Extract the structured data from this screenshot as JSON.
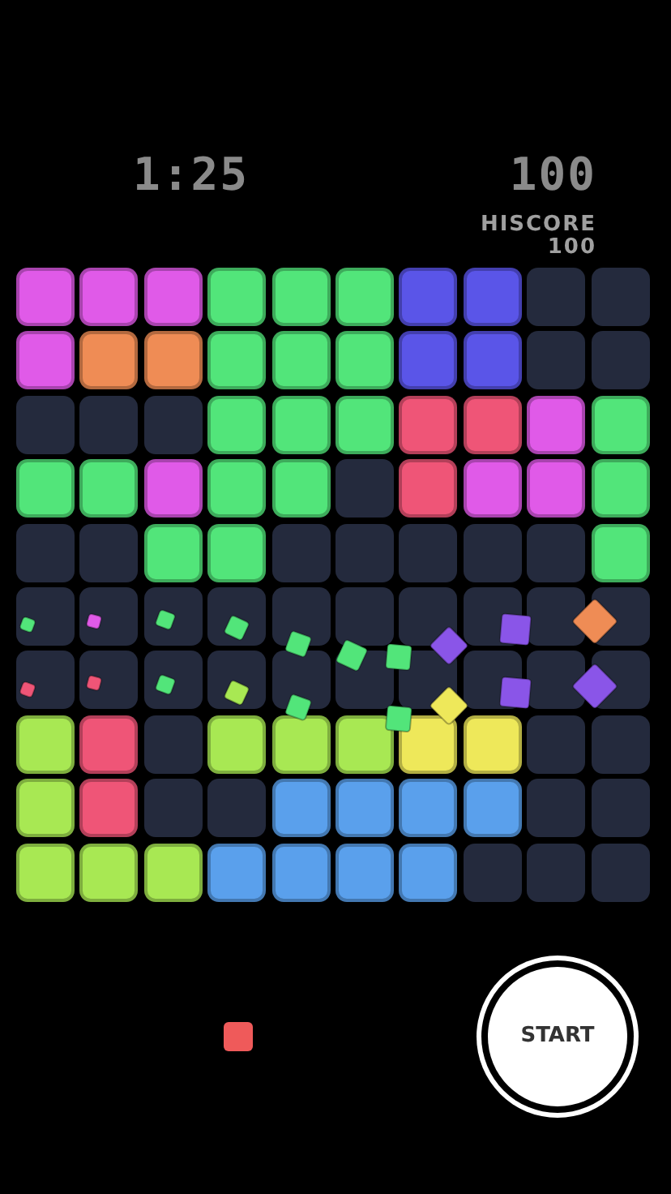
{
  "timer": "1:25",
  "score": "100",
  "hiscore": {
    "label": "HISCORE",
    "value": "100"
  },
  "grid": [
    [
      {
        "filled": true,
        "color": "#e05ae8"
      },
      {
        "filled": true,
        "color": "#e05ae8"
      },
      {
        "filled": true,
        "color": "#e05ae8"
      },
      {
        "filled": true,
        "color": "#52e57a"
      },
      {
        "filled": true,
        "color": "#52e57a"
      },
      {
        "filled": true,
        "color": "#52e57a"
      },
      {
        "filled": true,
        "color": "#5a55e8"
      },
      {
        "filled": true,
        "color": "#5a55e8"
      },
      {
        "filled": false
      },
      {
        "filled": false
      }
    ],
    [
      {
        "filled": true,
        "color": "#e05ae8"
      },
      {
        "filled": true,
        "color": "#ef8c55"
      },
      {
        "filled": true,
        "color": "#ef8c55"
      },
      {
        "filled": true,
        "color": "#52e57a"
      },
      {
        "filled": true,
        "color": "#52e57a"
      },
      {
        "filled": true,
        "color": "#52e57a"
      },
      {
        "filled": true,
        "color": "#5a55e8"
      },
      {
        "filled": true,
        "color": "#5a55e8"
      },
      {
        "filled": false
      },
      {
        "filled": false
      }
    ],
    [
      {
        "filled": false
      },
      {
        "filled": false
      },
      {
        "filled": false
      },
      {
        "filled": true,
        "color": "#52e57a"
      },
      {
        "filled": true,
        "color": "#52e57a"
      },
      {
        "filled": true,
        "color": "#52e57a"
      },
      {
        "filled": true,
        "color": "#ef5577"
      },
      {
        "filled": true,
        "color": "#ef5577"
      },
      {
        "filled": true,
        "color": "#e05ae8"
      },
      {
        "filled": true,
        "color": "#52e57a"
      }
    ],
    [
      {
        "filled": true,
        "color": "#52e57a"
      },
      {
        "filled": true,
        "color": "#52e57a"
      },
      {
        "filled": true,
        "color": "#e05ae8"
      },
      {
        "filled": true,
        "color": "#52e57a"
      },
      {
        "filled": true,
        "color": "#52e57a"
      },
      {
        "filled": false
      },
      {
        "filled": true,
        "color": "#ef5577"
      },
      {
        "filled": true,
        "color": "#e05ae8"
      },
      {
        "filled": true,
        "color": "#e05ae8"
      },
      {
        "filled": true,
        "color": "#52e57a"
      }
    ],
    [
      {
        "filled": false
      },
      {
        "filled": false
      },
      {
        "filled": true,
        "color": "#52e57a"
      },
      {
        "filled": true,
        "color": "#52e57a"
      },
      {
        "filled": false
      },
      {
        "filled": false
      },
      {
        "filled": false
      },
      {
        "filled": false
      },
      {
        "filled": false
      },
      {
        "filled": true,
        "color": "#52e57a"
      }
    ],
    [
      {
        "filled": false
      },
      {
        "filled": false
      },
      {
        "filled": false
      },
      {
        "filled": false
      },
      {
        "filled": false
      },
      {
        "filled": false
      },
      {
        "filled": false
      },
      {
        "filled": false
      },
      {
        "filled": false
      },
      {
        "filled": false
      }
    ],
    [
      {
        "filled": false
      },
      {
        "filled": false
      },
      {
        "filled": false
      },
      {
        "filled": false
      },
      {
        "filled": false
      },
      {
        "filled": false
      },
      {
        "filled": false
      },
      {
        "filled": false
      },
      {
        "filled": false
      },
      {
        "filled": false
      }
    ],
    [
      {
        "filled": true,
        "color": "#a8e853"
      },
      {
        "filled": true,
        "color": "#ef5577"
      },
      {
        "filled": false
      },
      {
        "filled": true,
        "color": "#a8e853"
      },
      {
        "filled": true,
        "color": "#a8e853"
      },
      {
        "filled": true,
        "color": "#a8e853"
      },
      {
        "filled": true,
        "color": "#eee85a"
      },
      {
        "filled": true,
        "color": "#eee85a"
      },
      {
        "filled": false
      },
      {
        "filled": false
      }
    ],
    [
      {
        "filled": true,
        "color": "#a8e853"
      },
      {
        "filled": true,
        "color": "#ef5577"
      },
      {
        "filled": false
      },
      {
        "filled": false
      },
      {
        "filled": true,
        "color": "#5aa0ec"
      },
      {
        "filled": true,
        "color": "#5aa0ec"
      },
      {
        "filled": true,
        "color": "#5aa0ec"
      },
      {
        "filled": true,
        "color": "#5aa0ec"
      },
      {
        "filled": false
      },
      {
        "filled": false
      }
    ],
    [
      {
        "filled": true,
        "color": "#a8e853"
      },
      {
        "filled": true,
        "color": "#a8e853"
      },
      {
        "filled": true,
        "color": "#a8e853"
      },
      {
        "filled": true,
        "color": "#5aa0ec"
      },
      {
        "filled": true,
        "color": "#5aa0ec"
      },
      {
        "filled": true,
        "color": "#5aa0ec"
      },
      {
        "filled": true,
        "color": "#5aa0ec"
      },
      {
        "filled": false
      },
      {
        "filled": false
      },
      {
        "filled": false
      }
    ]
  ],
  "next_block": {
    "color": "#ef5a5a"
  },
  "start_button": "START"
}
